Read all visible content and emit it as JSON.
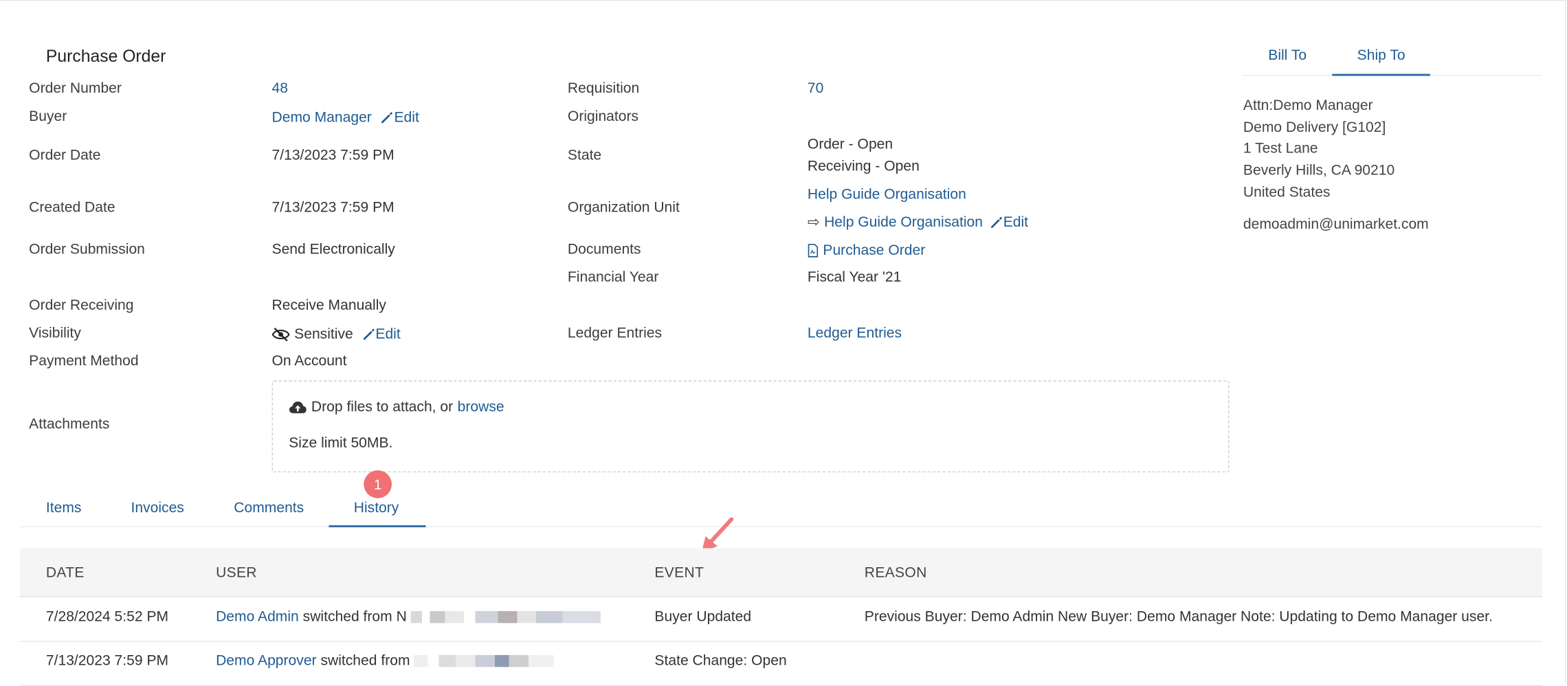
{
  "page": {
    "title": "Purchase Order"
  },
  "left_fields": [
    {
      "label": "Order Number",
      "value": "48"
    },
    {
      "label": "Buyer",
      "value": "Demo Manager",
      "edit": "Edit"
    },
    {
      "label": "Order Date",
      "value": "7/13/2023 7:59 PM"
    },
    {
      "label": "Created Date",
      "value": "7/13/2023 7:59 PM"
    },
    {
      "label": "Order Submission",
      "value": "Send Electronically"
    },
    {
      "label": "Order Receiving",
      "value": "Receive Manually"
    },
    {
      "label": "Visibility",
      "value": "Sensitive",
      "edit": "Edit"
    },
    {
      "label": "Payment Method",
      "value": "On Account"
    },
    {
      "label": "Attachments"
    }
  ],
  "right_fields": {
    "requisition": {
      "label": "Requisition",
      "value": "70"
    },
    "originators": {
      "label": "Originators"
    },
    "state": {
      "label": "State",
      "value_1": "Order - Open",
      "value_2": "Receiving - Open"
    },
    "org_unit": {
      "label": "Organization Unit",
      "value_1": "Help Guide Organisation",
      "value_2": "Help Guide Organisation",
      "edit": "Edit"
    },
    "documents": {
      "label": "Documents",
      "value": "Purchase Order"
    },
    "financial_year": {
      "label": "Financial Year",
      "value": "Fiscal Year '21"
    },
    "ledger": {
      "label": "Ledger Entries",
      "value": "Ledger Entries"
    }
  },
  "attachments": {
    "drop_text": "Drop files to attach, or",
    "browse": "browse",
    "size_limit": "Size limit 50MB."
  },
  "address_tabs": {
    "bill_to": "Bill To",
    "ship_to": "Ship To",
    "active": "Ship To"
  },
  "address": {
    "line1": "Attn:Demo Manager",
    "line2": "Demo Delivery [G102]",
    "line3": "1 Test Lane",
    "line4": "Beverly Hills, CA 90210",
    "line5": "United States",
    "email": "demoadmin@unimarket.com"
  },
  "tabs": {
    "items": "Items",
    "invoices": "Invoices",
    "comments": "Comments",
    "history": "History",
    "active": "History",
    "badge": "1"
  },
  "history": {
    "columns": {
      "date": "DATE",
      "user": "USER",
      "event": "EVENT",
      "reason": "REASON"
    },
    "rows": [
      {
        "date": "7/28/2024 5:52 PM",
        "user": "Demo Admin",
        "user_suffix": "switched from N",
        "event": "Buyer Updated",
        "reason": "Previous Buyer: Demo Admin New Buyer: Demo Manager Note: Updating to Demo Manager user."
      },
      {
        "date": "7/13/2023 7:59 PM",
        "user": "Demo Approver",
        "user_suffix": "switched from",
        "event": "State Change: Open",
        "reason": ""
      }
    ]
  },
  "colors": {
    "link": "#1f5b92",
    "accent": "#2b6aa6",
    "badge": "#f17073",
    "arrow": "#f27a7d"
  }
}
